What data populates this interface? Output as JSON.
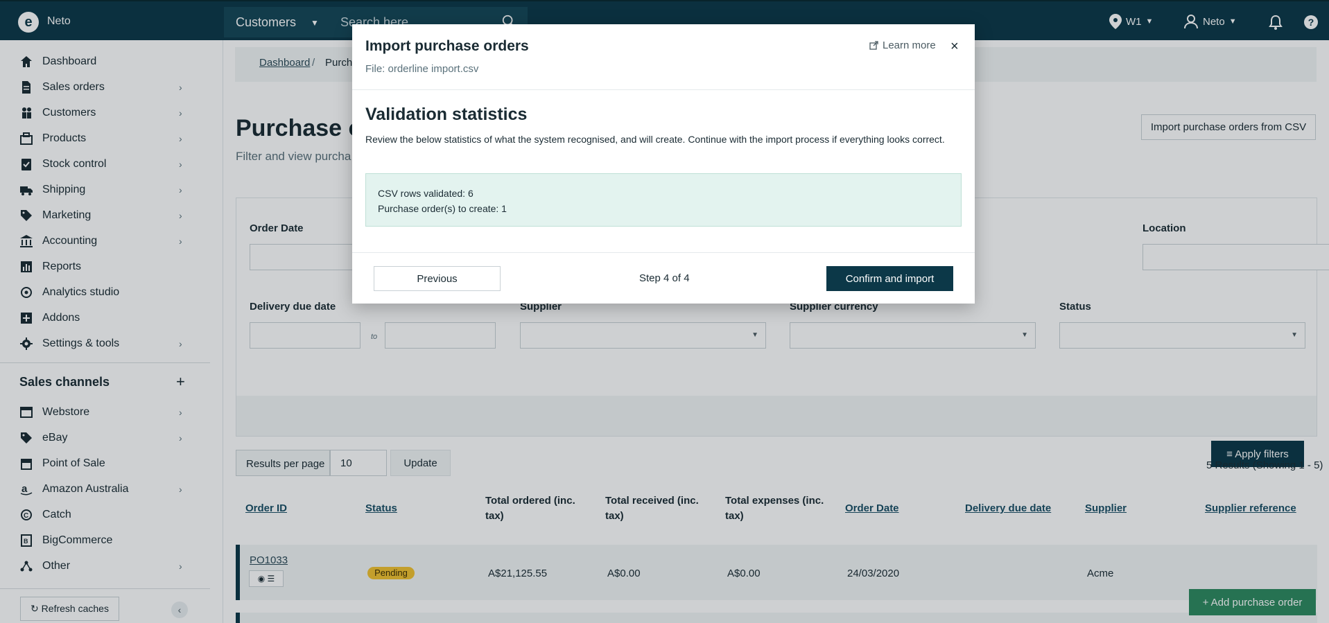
{
  "topbar": {
    "logo_letter": "e",
    "brand": "Neto",
    "search_scope": "Customers",
    "search_placeholder": "Search here",
    "location": "W1",
    "user": "Neto"
  },
  "sidebar": {
    "items": [
      {
        "label": "Dashboard",
        "icon": "home-icon",
        "has_children": false
      },
      {
        "label": "Sales orders",
        "icon": "document-icon",
        "has_children": true
      },
      {
        "label": "Customers",
        "icon": "people-icon",
        "has_children": true
      },
      {
        "label": "Products",
        "icon": "box-icon",
        "has_children": true
      },
      {
        "label": "Stock control",
        "icon": "clipboard-check-icon",
        "has_children": true
      },
      {
        "label": "Shipping",
        "icon": "truck-icon",
        "has_children": true
      },
      {
        "label": "Marketing",
        "icon": "tag-icon",
        "has_children": true
      },
      {
        "label": "Accounting",
        "icon": "bank-icon",
        "has_children": true
      },
      {
        "label": "Reports",
        "icon": "bar-chart-icon",
        "has_children": false
      },
      {
        "label": "Analytics studio",
        "icon": "analytics-icon",
        "has_children": false
      },
      {
        "label": "Addons",
        "icon": "plus-square-icon",
        "has_children": false
      },
      {
        "label": "Settings & tools",
        "icon": "gear-icon",
        "has_children": true
      }
    ],
    "channels_title": "Sales channels",
    "channels": [
      {
        "label": "Webstore",
        "icon": "browser-icon",
        "has_children": true
      },
      {
        "label": "eBay",
        "icon": "tag-icon",
        "has_children": true
      },
      {
        "label": "Point of Sale",
        "icon": "store-icon",
        "has_children": false
      },
      {
        "label": "Amazon Australia",
        "icon": "amazon-icon",
        "has_children": true
      },
      {
        "label": "Catch",
        "icon": "catch-icon",
        "has_children": false
      },
      {
        "label": "BigCommerce",
        "icon": "bigcommerce-icon",
        "has_children": false
      },
      {
        "label": "Other",
        "icon": "network-icon",
        "has_children": true
      }
    ],
    "refresh_label": "Refresh caches"
  },
  "main": {
    "breadcrumb": {
      "home": "Dashboard",
      "separator": "/",
      "current": "Purchase"
    },
    "title": "Purchase o",
    "subtitle": "Filter and view purcha",
    "import_button": "Import purchase orders from CSV",
    "filters": {
      "order_date": "Order Date",
      "location": "Location",
      "delivery_due_date": "Delivery due date",
      "to": "to",
      "supplier": "Supplier",
      "supplier_currency": "Supplier currency",
      "status": "Status",
      "apply": "Apply filters"
    },
    "results_per_page_label": "Results per page",
    "results_per_page_value": "10",
    "update_button": "Update",
    "results_count": "5 Results (Showing 1 - 5)",
    "table": {
      "headers": {
        "order_id": "Order ID",
        "status": "Status",
        "total_ordered": "Total ordered (inc. tax)",
        "total_received": "Total received (inc. tax)",
        "total_expenses": "Total expenses (inc. tax)",
        "order_date": "Order Date",
        "delivery_due_date": "Delivery due date",
        "supplier": "Supplier",
        "supplier_reference": "Supplier reference"
      },
      "rows": [
        {
          "order_id": "PO1033",
          "status": "Pending",
          "total_ordered": "A$21,125.55",
          "total_received": "A$0.00",
          "total_expenses": "A$0.00",
          "order_date": "24/03/2020",
          "supplier": "Acme"
        }
      ]
    },
    "add_button": "+ Add purchase order"
  },
  "modal": {
    "title": "Import purchase orders",
    "file": "File: orderline import.csv",
    "learn_more": "Learn more",
    "close": "×",
    "heading": "Validation statistics",
    "description": "Review the below statistics of what the system recognised, and will create. Continue with the import process if everything looks correct.",
    "stats": [
      "CSV rows validated: 6",
      "Purchase order(s) to create: 1"
    ],
    "previous": "Previous",
    "step": "Step 4 of 4",
    "confirm": "Confirm and import"
  },
  "colors": {
    "navy": "#0c3848",
    "badge_pending": "#f2c230",
    "stats_bg": "#e3f3ef",
    "add_green": "#2e8a5f"
  }
}
